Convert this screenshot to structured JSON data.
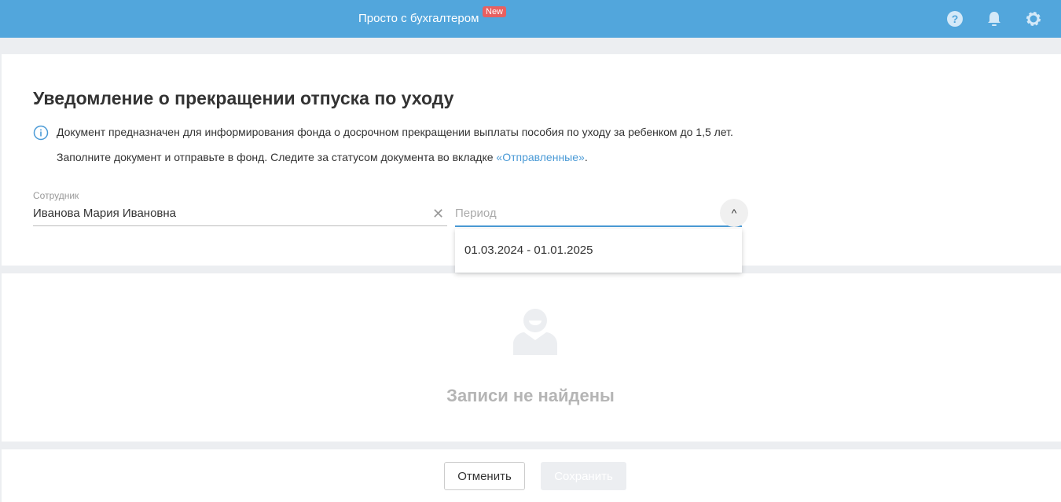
{
  "header": {
    "brand": "Просто с бухгалтером",
    "badge": "New",
    "icons": [
      "help-icon",
      "bell-icon",
      "gear-icon"
    ]
  },
  "page": {
    "title": "Уведомление о прекращении отпуска по уходу",
    "info_line1": "Документ предназначен для информирования фонда о досрочном прекращении выплаты пособия по уходу за ребенком до 1,5 лет.",
    "info_line2_prefix": "Заполните документ и отправьте в фонд. Следите за статусом документа во вкладке ",
    "info_link": "«Отправленные»",
    "info_line2_suffix": "."
  },
  "form": {
    "employee_label": "Сотрудник",
    "employee_value": "Иванова Мария Ивановна",
    "period_placeholder": "Период",
    "period_options": [
      "01.03.2024 - 01.01.2025"
    ]
  },
  "empty": {
    "text": "Записи не найдены"
  },
  "footer": {
    "cancel": "Отменить",
    "save": "Сохранить"
  }
}
